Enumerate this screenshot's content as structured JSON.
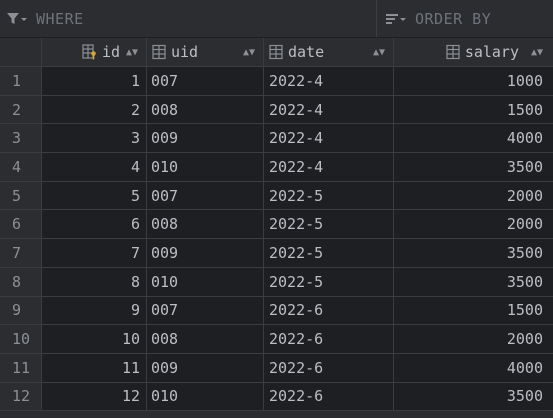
{
  "filters": {
    "where_label": "WHERE",
    "order_label": "ORDER BY"
  },
  "columns": [
    {
      "name": "id",
      "icon": "primary-key-column-icon"
    },
    {
      "name": "uid",
      "icon": "column-icon"
    },
    {
      "name": "date",
      "icon": "column-icon"
    },
    {
      "name": "salary",
      "icon": "column-icon"
    }
  ],
  "rows": [
    {
      "n": "1",
      "id": "1",
      "uid": "007",
      "date": "2022-4",
      "salary": "1000"
    },
    {
      "n": "2",
      "id": "2",
      "uid": "008",
      "date": "2022-4",
      "salary": "1500"
    },
    {
      "n": "3",
      "id": "3",
      "uid": "009",
      "date": "2022-4",
      "salary": "4000"
    },
    {
      "n": "4",
      "id": "4",
      "uid": "010",
      "date": "2022-4",
      "salary": "3500"
    },
    {
      "n": "5",
      "id": "5",
      "uid": "007",
      "date": "2022-5",
      "salary": "2000"
    },
    {
      "n": "6",
      "id": "6",
      "uid": "008",
      "date": "2022-5",
      "salary": "2000"
    },
    {
      "n": "7",
      "id": "7",
      "uid": "009",
      "date": "2022-5",
      "salary": "3500"
    },
    {
      "n": "8",
      "id": "8",
      "uid": "010",
      "date": "2022-5",
      "salary": "3500"
    },
    {
      "n": "9",
      "id": "9",
      "uid": "007",
      "date": "2022-6",
      "salary": "1500"
    },
    {
      "n": "10",
      "id": "10",
      "uid": "008",
      "date": "2022-6",
      "salary": "2000"
    },
    {
      "n": "11",
      "id": "11",
      "uid": "009",
      "date": "2022-6",
      "salary": "4000"
    },
    {
      "n": "12",
      "id": "12",
      "uid": "010",
      "date": "2022-6",
      "salary": "3500"
    }
  ]
}
